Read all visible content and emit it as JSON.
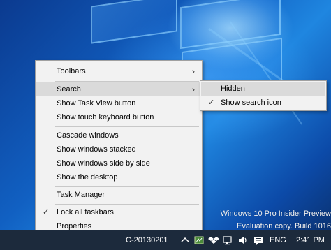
{
  "context_menu": {
    "items": [
      {
        "label": "Toolbars",
        "arrow": "›"
      },
      {
        "label": "Search",
        "arrow": "›"
      },
      {
        "label": "Show Task View button"
      },
      {
        "label": "Show touch keyboard button"
      },
      {
        "label": "Cascade windows"
      },
      {
        "label": "Show windows stacked"
      },
      {
        "label": "Show windows side by side"
      },
      {
        "label": "Show the desktop"
      },
      {
        "label": "Task Manager"
      },
      {
        "label": "Lock all taskbars",
        "check": "✓"
      },
      {
        "label": "Properties"
      }
    ]
  },
  "search_submenu": {
    "items": [
      {
        "label": "Hidden"
      },
      {
        "label": "Show search icon",
        "check": "✓"
      }
    ]
  },
  "watermark": {
    "line1": "Windows 10 Pro Insider Preview",
    "line2": "Evaluation copy. Build 1016"
  },
  "taskbar": {
    "computer_name": "C-20130201",
    "language": "ENG",
    "time": "2:41 PM"
  },
  "colors": {
    "menu_bg": "#f2f2f2",
    "hover_bg": "#dadada",
    "taskbar_bg": "#1c2a3c"
  }
}
